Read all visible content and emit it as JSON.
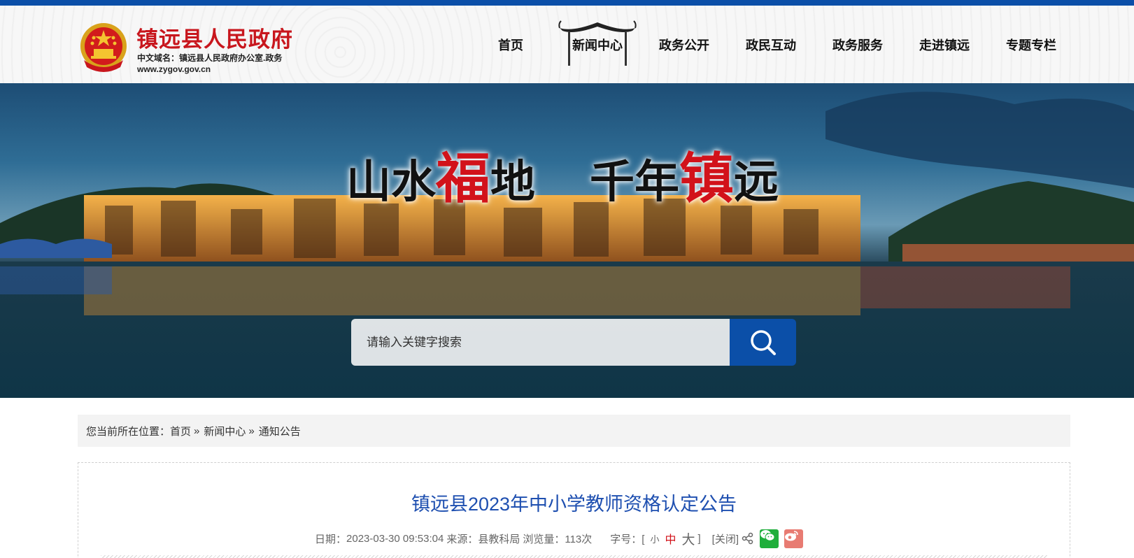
{
  "site": {
    "title": "镇远县人民政府",
    "domain_label": "中文域名：镇远县人民政府办公室.政务",
    "url": "www.zygov.gov.cn"
  },
  "nav": {
    "items": [
      {
        "label": "首页"
      },
      {
        "label": "新闻中心"
      },
      {
        "label": "政务公开"
      },
      {
        "label": "政民互动"
      },
      {
        "label": "政务服务"
      },
      {
        "label": "走进镇远"
      },
      {
        "label": "专题专栏"
      }
    ],
    "active": "新闻中心"
  },
  "banner": {
    "slogan_left": {
      "a": "山水",
      "b": "福",
      "c": "地"
    },
    "slogan_right": {
      "a": "千年",
      "b": "镇",
      "c": "远"
    }
  },
  "search": {
    "placeholder": "请输入关键字搜索"
  },
  "breadcrumb": {
    "prefix": "您当前所在位置：",
    "items": [
      "首页",
      "新闻中心",
      "通知公告"
    ],
    "sep": "»"
  },
  "article": {
    "title": "镇远县2023年中小学教师资格认定公告",
    "date_label": "日期：",
    "date": "2023-03-30 09:53:04",
    "source_label": "来源：",
    "source": "县教科局",
    "views_label": "浏览量：",
    "views": "113次",
    "fontsize_label": "字号：[",
    "fontsize_end": "]",
    "fontsize_small": "小",
    "fontsize_mid": "中",
    "fontsize_big": "大",
    "close": "[关闭]"
  },
  "icons": [
    "emblem-icon",
    "roof-icon",
    "search-icon",
    "share-icon",
    "wechat-icon",
    "weibo-icon"
  ],
  "colors": {
    "brand_blue": "#0b4fa8",
    "title_red": "#c8161d",
    "title_blue": "#1e4fb0"
  }
}
